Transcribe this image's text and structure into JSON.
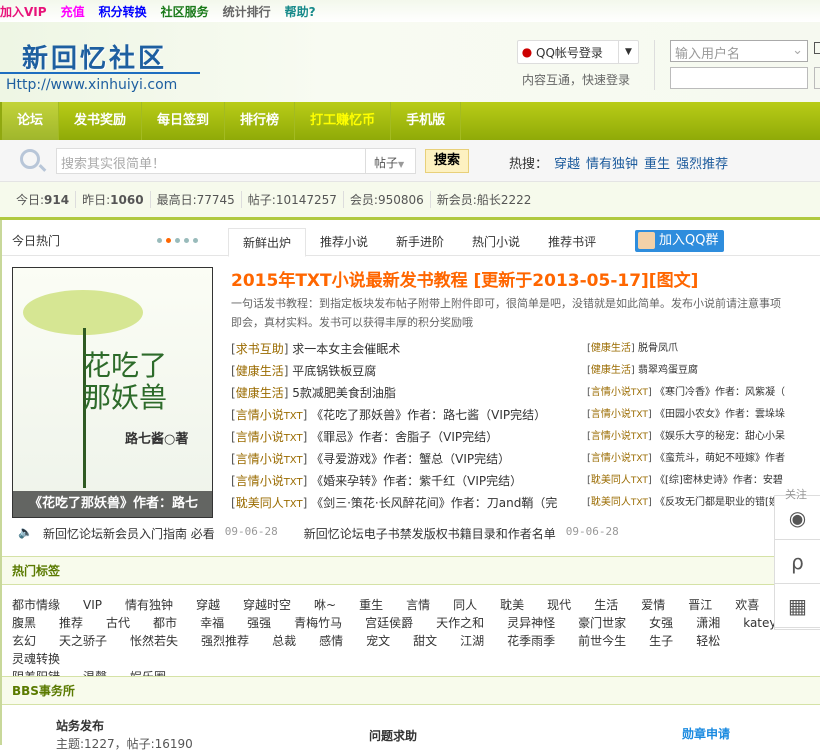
{
  "topbar": [
    {
      "label": "加入VIP",
      "color": "#e8137a"
    },
    {
      "label": "充值",
      "color": "#f0f"
    },
    {
      "label": "积分转换",
      "color": "#00f"
    },
    {
      "label": "社区服务",
      "color": "#1a7a1a"
    },
    {
      "label": "统计排行",
      "color": "#666"
    },
    {
      "label": "帮助?",
      "color": "#178a8a"
    }
  ],
  "header": {
    "logo": "新回忆社区",
    "url": "Http://www.xinhuiyi.com",
    "qq_login": "QQ帐号登录",
    "qq_sub": "内容互通，快速登录",
    "username_placeholder": "输入用户名"
  },
  "nav": [
    "论坛",
    "发书奖励",
    "每日签到",
    "排行榜",
    "打工赚忆币",
    "手机版"
  ],
  "search": {
    "placeholder": "搜索其实很简单！",
    "type": "帖子",
    "button": "搜索",
    "hot_label": "热搜：",
    "hot": [
      "穿越",
      "情有独钟",
      "重生",
      "强烈推荐"
    ]
  },
  "stats": [
    {
      "k": "今日:",
      "v": "914"
    },
    {
      "k": "昨日:",
      "v": "1060"
    },
    {
      "k": "最高日:",
      "v": "77745"
    },
    {
      "k": "帖子:",
      "v": "10147257"
    },
    {
      "k": "会员:",
      "v": "950806"
    },
    {
      "k": "新会员:",
      "v": "船长2222"
    }
  ],
  "hot_today": {
    "label": "今日热门",
    "tabs": [
      "新鲜出炉",
      "推荐小说",
      "新手进阶",
      "热门小说",
      "推荐书评"
    ],
    "qq_group": "加入QQ群",
    "cover_caption": "《花吃了那妖兽》作者：路七",
    "cover_title": "花吃了那妖兽",
    "cover_author": "路七酱○著",
    "headline": "2015年TXT小说最新发书教程 [更新于2013-05-17][图文]",
    "desc1": "一句话发书教程：到指定板块发布帖子附带上附件即可，很简单是吧，没错就是如此简单。发布小说前请注意事项",
    "desc2": "即会，真材实料。发书可以获得丰厚的积分奖励哦",
    "left": [
      {
        "c": "求书互助",
        "t": "",
        "s": "求一本女主会催眠术"
      },
      {
        "c": "健康生活",
        "t": "",
        "s": "平底锅铁板豆腐"
      },
      {
        "c": "健康生活",
        "t": "",
        "s": "5款减肥美食刮油脂"
      },
      {
        "c": "言情小说",
        "t": "TXT",
        "s": "《花吃了那妖兽》作者：路七酱（VIP完结）"
      },
      {
        "c": "言情小说",
        "t": "TXT",
        "s": "《罪忌》作者：舍脂子（VIP完结）"
      },
      {
        "c": "言情小说",
        "t": "TXT",
        "s": "《寻爱游戏》作者：蟹总（VIP完结）"
      },
      {
        "c": "言情小说",
        "t": "TXT",
        "s": "《婚来孕转》作者：紫千红（VIP完结）"
      },
      {
        "c": "耽美同人",
        "t": "TXT",
        "s": "《剑三·策花·长风醉花间》作者：刀and鞘（完"
      }
    ],
    "right": [
      {
        "c": "健康生活",
        "t": "",
        "s": "脱骨凤爪"
      },
      {
        "c": "健康生活",
        "t": "",
        "s": "翡翠鸡蛋豆腐"
      },
      {
        "c": "言情小说",
        "t": "TXT",
        "s": "《寒门冷香》作者：风紫凝（"
      },
      {
        "c": "言情小说",
        "t": "TXT",
        "s": "《田园小农女》作者：雲垛垛"
      },
      {
        "c": "言情小说",
        "t": "TXT",
        "s": "《娱乐大亨的秘宠：甜心小呆"
      },
      {
        "c": "言情小说",
        "t": "TXT",
        "s": "《蛮荒斗，萌妃不哑嫁》作者"
      },
      {
        "c": "耽美同人",
        "t": "TXT",
        "s": "《[综]密林史诗》作者：安碧"
      },
      {
        "c": "耽美同人",
        "t": "TXT",
        "s": "《反攻无门都是职业的错[娱"
      }
    ],
    "notices": [
      {
        "t": "新回忆论坛新会员入门指南 必看",
        "d": "09-06-28"
      },
      {
        "t": "新回忆论坛电子书禁发版权书籍目录和作者名单",
        "d": "09-06-28"
      }
    ]
  },
  "tags": {
    "title": "热门标签",
    "rows": [
      [
        "都市情缘",
        "VIP",
        "情有独钟",
        "穿越",
        "穿越时空",
        "咻~",
        "重生",
        "言情",
        "同人",
        "耽美",
        "现代",
        "生活",
        "爱情",
        "晋江",
        "欢喜"
      ],
      [
        "腹黑",
        "推荐",
        "古代",
        "都市",
        "幸福",
        "强强",
        "青梅竹马",
        "宫廷侯爵",
        "天作之和",
        "灵异神怪",
        "豪门世家",
        "女强",
        "潇湘",
        "katey"
      ],
      [
        "玄幻",
        "天之骄子",
        "怅然若失",
        "强烈推荐",
        "总裁",
        "感情",
        "宠文",
        "甜文",
        "江湖",
        "花季雨季",
        "前世今生",
        "生子",
        "轻松",
        "灵魂转换"
      ],
      [
        "阴差阳错",
        "温馨",
        "娱乐圈"
      ]
    ]
  },
  "bbs": {
    "title": "BBS事务所",
    "items": [
      {
        "name": "站务发布",
        "meta": "主题:1227，帖子:16190"
      },
      {
        "name": "问题求助"
      },
      {
        "name": "勋章申请"
      }
    ]
  },
  "float": {
    "label": "关注"
  }
}
